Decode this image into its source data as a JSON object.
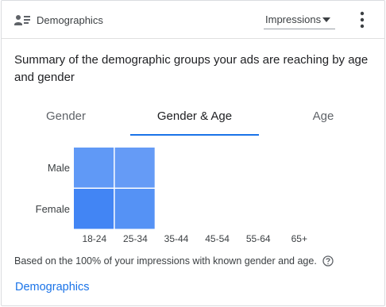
{
  "header": {
    "title": "Demographics",
    "icon": "person-list-icon",
    "metric_select": {
      "selected": "Impressions"
    },
    "more_icon": "more-vert-icon"
  },
  "summary_text": "Summary of the demographic groups your ads are reaching by age and gender",
  "tabs": [
    {
      "label": "Gender",
      "active": false
    },
    {
      "label": "Gender & Age",
      "active": true
    },
    {
      "label": "Age",
      "active": false
    }
  ],
  "chart_data": {
    "type": "heatmap",
    "rows": [
      "Male",
      "Female"
    ],
    "columns": [
      "18-24",
      "25-34",
      "35-44",
      "45-54",
      "55-64",
      "65+"
    ],
    "values": [
      [
        0.72,
        0.68,
        0,
        0,
        0,
        0
      ],
      [
        1.0,
        0.82,
        0,
        0,
        0,
        0
      ]
    ],
    "color_low": "#aecbfa",
    "color_high": "#4285f4"
  },
  "footnote": "Based on the 100% of your impressions with known gender and age.",
  "link_label": "Demographics",
  "colors": {
    "accent": "#1a73e8",
    "cell_high": "#4285f4",
    "cell_low": "#aecbfa"
  }
}
